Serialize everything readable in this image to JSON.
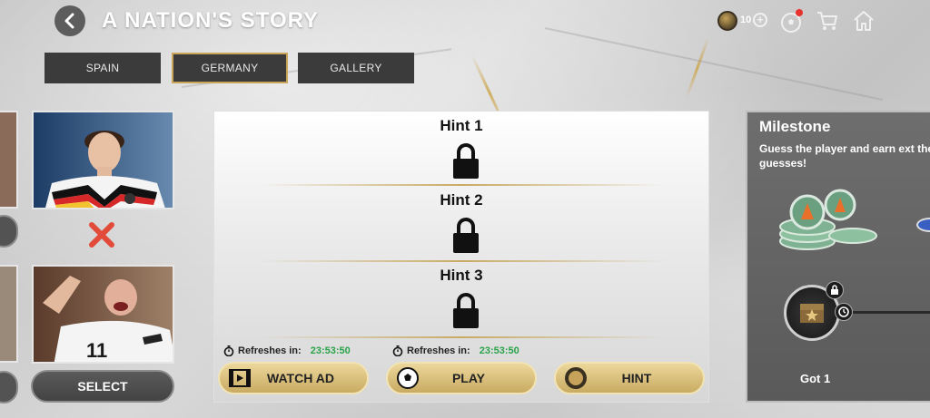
{
  "header": {
    "title": "A NATION'S STORY",
    "coin_count": "10",
    "icons": [
      "back-arrow-icon",
      "coin-icon",
      "plus-icon",
      "football-icon",
      "cart-icon",
      "home-icon"
    ]
  },
  "tabs": [
    {
      "label": "SPAIN",
      "active": false
    },
    {
      "label": "GERMANY",
      "active": true
    },
    {
      "label": "GALLERY",
      "active": false
    }
  ],
  "players": {
    "select_label": "SELECT",
    "first_guess_result": "wrong"
  },
  "hints": [
    {
      "label": "Hint 1",
      "locked": true
    },
    {
      "label": "Hint 2",
      "locked": true
    },
    {
      "label": "Hint 3",
      "locked": true
    }
  ],
  "refresh": {
    "label": "Refreshes in:",
    "ad_timer": "23:53:50",
    "play_timer": "23:53:50"
  },
  "buttons": {
    "watch_ad": "WATCH AD",
    "play": "PLAY",
    "hint": "HINT"
  },
  "milestone": {
    "title": "Milestone",
    "description": "Guess the player and earn ext the correct guesses!",
    "progress_label": "Got 1"
  },
  "colors": {
    "accent_gold": "#c9a65a",
    "timer_green": "#2aa34a",
    "wrong_red": "#e24a3a"
  }
}
